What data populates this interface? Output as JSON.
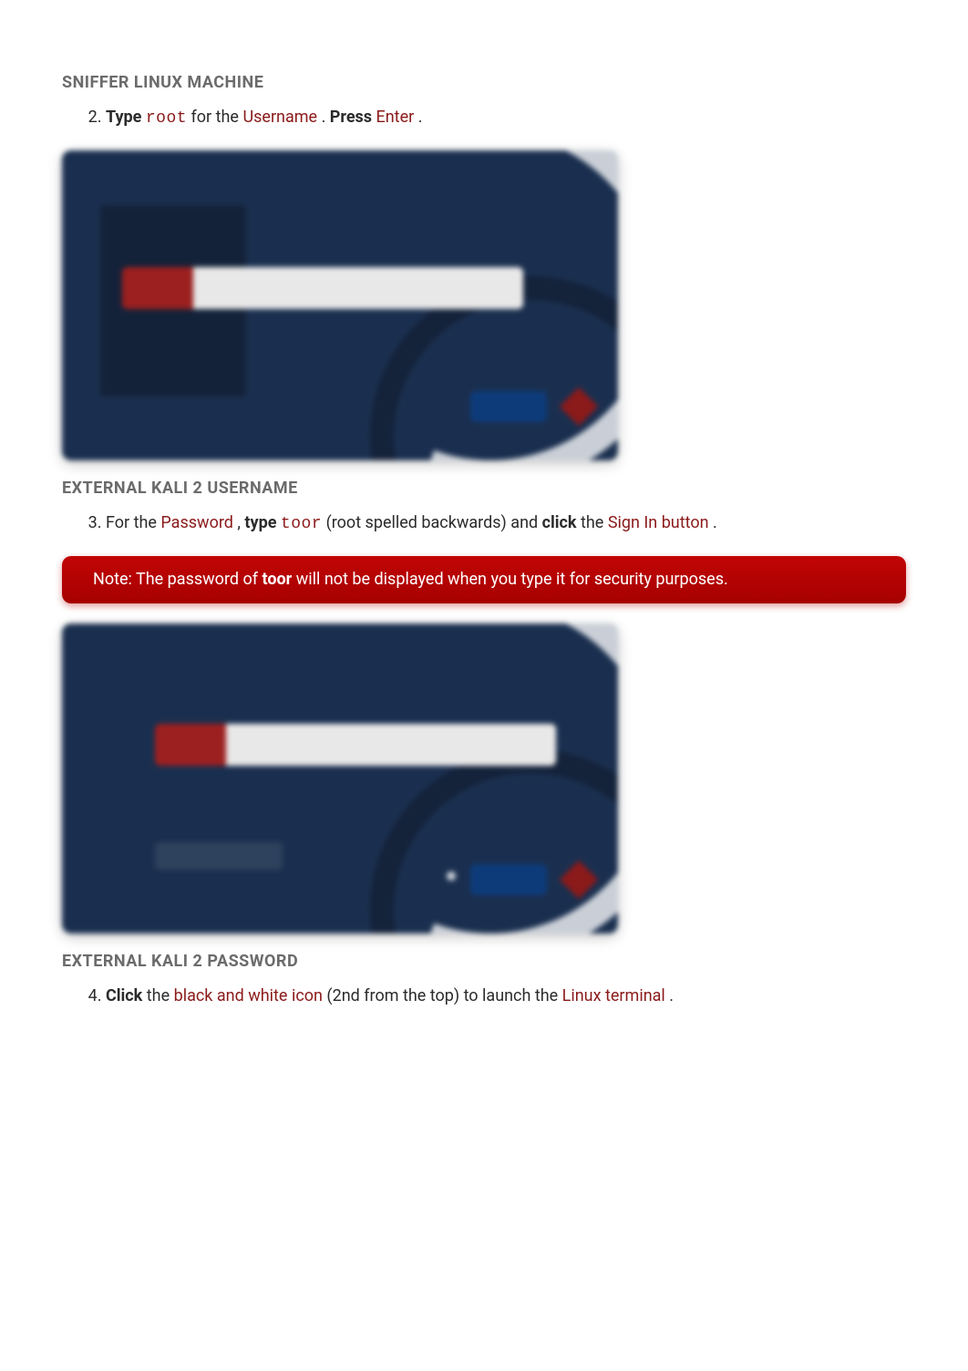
{
  "captions": {
    "c1": "SNIFFER LINUX MACHINE",
    "c2": "EXTERNAL KALI 2 USERNAME",
    "c3": "EXTERNAL KALI 2 PASSWORD"
  },
  "step2": {
    "num": "2.",
    "type_label": "Type",
    "root_code": "root",
    "for_the": " for the ",
    "username": "Username",
    "dot1": ". ",
    "press_label": "Press",
    "enter": "Enter",
    "dot2": "."
  },
  "step3": {
    "num": "3.",
    "for_the": "For the ",
    "password": "Password",
    "comma": ", ",
    "type_label": "type",
    "toor_code": "toor",
    "root_back": " (root spelled backwards) and ",
    "click_label": "click",
    "the": " the ",
    "signin": "Sign In button",
    "dot": "."
  },
  "note": {
    "prefix": "Note: The password of ",
    "toor": "toor",
    "suffix": " will not be displayed when you type it for security purposes."
  },
  "step4": {
    "num": "4.",
    "click_label": "Click",
    "the1": " the ",
    "bwicon": "black and white icon",
    "middle": " (2nd from the top) to launch the ",
    "terminal": "Linux terminal",
    "dot": "."
  }
}
